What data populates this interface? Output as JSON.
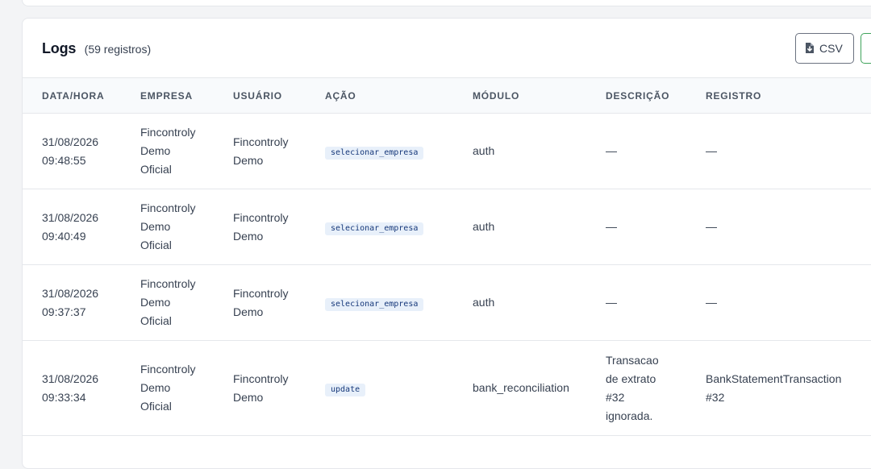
{
  "logs": {
    "title": "Logs",
    "count": "(59 registros)",
    "csv_button": "CSV",
    "columns": [
      "DATA/HORA",
      "EMPRESA",
      "USUÁRIO",
      "AÇÃO",
      "MÓDULO",
      "DESCRIÇÃO",
      "REGISTRO"
    ],
    "rows": [
      {
        "date": "31/08/2026",
        "time": "09:48:55",
        "company": [
          "Fincontroly",
          "Demo",
          "Oficial"
        ],
        "user": [
          "Fincontroly",
          "Demo"
        ],
        "action": "selecionar_empresa",
        "module": "auth",
        "description": [
          "—"
        ],
        "record": [
          "—"
        ]
      },
      {
        "date": "31/08/2026",
        "time": "09:40:49",
        "company": [
          "Fincontroly",
          "Demo",
          "Oficial"
        ],
        "user": [
          "Fincontroly",
          "Demo"
        ],
        "action": "selecionar_empresa",
        "module": "auth",
        "description": [
          "—"
        ],
        "record": [
          "—"
        ]
      },
      {
        "date": "31/08/2026",
        "time": "09:37:37",
        "company": [
          "Fincontroly",
          "Demo",
          "Oficial"
        ],
        "user": [
          "Fincontroly",
          "Demo"
        ],
        "action": "selecionar_empresa",
        "module": "auth",
        "description": [
          "—"
        ],
        "record": [
          "—"
        ]
      },
      {
        "date": "31/08/2026",
        "time": "09:33:34",
        "company": [
          "Fincontroly",
          "Demo",
          "Oficial"
        ],
        "user": [
          "Fincontroly",
          "Demo"
        ],
        "action": "update",
        "module": "bank_reconciliation",
        "description": [
          "Transacao",
          "de extrato",
          "#32",
          "ignorada."
        ],
        "record": [
          "BankStatementTransaction",
          "#32"
        ]
      }
    ]
  },
  "icons": {
    "csv": "file-download-icon"
  },
  "colors": {
    "page_bg": "#f3f4f6",
    "table_header_bg": "#f8fafc",
    "badge_bg": "#e8f0fa",
    "badge_text": "#16387a",
    "green_button_border": "#3fa35b"
  }
}
